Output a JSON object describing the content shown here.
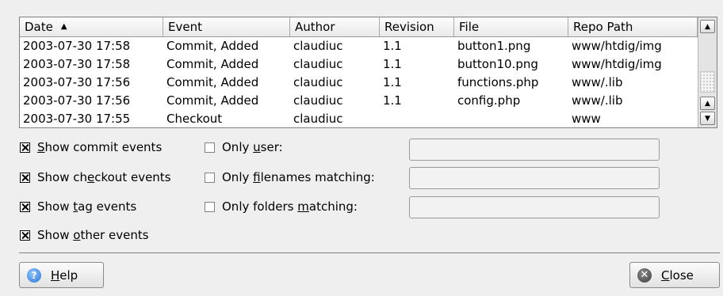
{
  "table": {
    "columns": [
      "Date",
      "Event",
      "Author",
      "Revision",
      "File",
      "Repo Path"
    ],
    "sort_indicator": "▲",
    "rows": [
      [
        "2003-07-30 17:58",
        "Commit, Added",
        "claudiuc",
        "1.1",
        "button1.png",
        "www/htdig/img"
      ],
      [
        "2003-07-30 17:58",
        "Commit, Added",
        "claudiuc",
        "1.1",
        "button10.png",
        "www/htdig/img"
      ],
      [
        "2003-07-30 17:56",
        "Commit, Added",
        "claudiuc",
        "1.1",
        "functions.php",
        "www/.lib"
      ],
      [
        "2003-07-30 17:56",
        "Commit, Added",
        "claudiuc",
        "1.1",
        "config.php",
        "www/.lib"
      ],
      [
        "2003-07-30 17:55",
        "Checkout",
        "claudiuc",
        "",
        "",
        "www"
      ]
    ]
  },
  "options": {
    "show_commit": {
      "pre": "",
      "key": "S",
      "post": "how commit events",
      "checked": true
    },
    "show_checkout": {
      "pre": "Show ch",
      "key": "e",
      "post": "ckout events",
      "checked": true
    },
    "show_tag": {
      "pre": "Show ",
      "key": "t",
      "post": "ag events",
      "checked": true
    },
    "show_other": {
      "pre": "Show ",
      "key": "o",
      "post": "ther events",
      "checked": true
    },
    "only_user": {
      "pre": "Only ",
      "key": "u",
      "post": "ser:",
      "checked": false,
      "value": ""
    },
    "only_filenames": {
      "pre": "Only ",
      "key": "f",
      "post": "ilenames matching:",
      "checked": false,
      "value": ""
    },
    "only_folders": {
      "pre": "Only folders ",
      "key": "m",
      "post": "atching:",
      "checked": false,
      "value": ""
    }
  },
  "buttons": {
    "help": {
      "pre": "",
      "key": "H",
      "post": "elp",
      "icon": "help-icon"
    },
    "close": {
      "pre": "",
      "key": "C",
      "post": "lose",
      "icon": "close-icon"
    }
  }
}
